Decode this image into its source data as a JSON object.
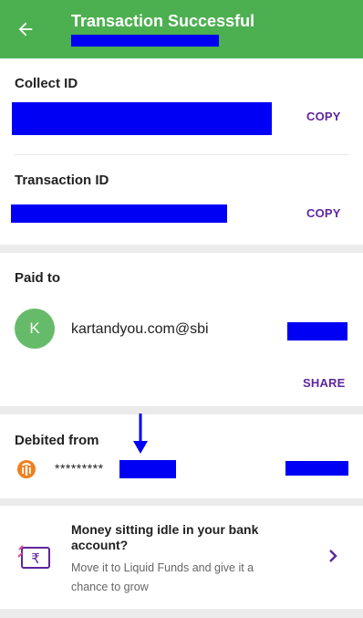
{
  "header": {
    "title": "Transaction Successful",
    "back_icon": "arrow-left-icon"
  },
  "collect": {
    "label": "Collect ID",
    "copy_label": "COPY"
  },
  "transaction": {
    "label": "Transaction ID",
    "copy_label": "COPY"
  },
  "paid_to": {
    "label": "Paid to",
    "avatar_letter": "K",
    "payee": "kartandyou.com@sbi",
    "share_label": "SHARE"
  },
  "debited": {
    "label": "Debited from",
    "account_mask": "*********"
  },
  "promo": {
    "title": "Money sitting idle in your bank account?",
    "subtitle": "Move it to Liquid Funds and give it a chance to grow"
  },
  "colors": {
    "header": "#4caf50",
    "accent": "#5f259f",
    "redaction": "#0000f5"
  }
}
